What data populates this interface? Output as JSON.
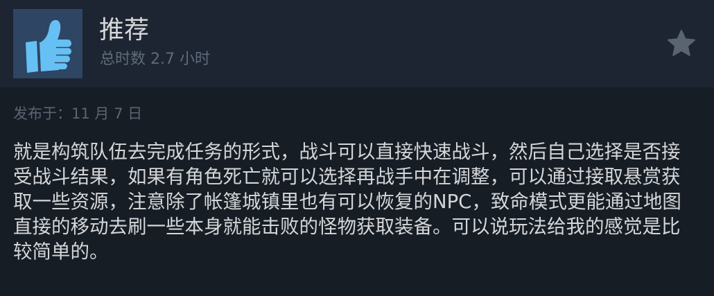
{
  "review": {
    "verdict": "推荐",
    "hours": "总时数 2.7 小时",
    "posted": "发布于：11 月 7 日",
    "text": "就是构筑队伍去完成任务的形式，战斗可以直接快速战斗，然后自己选择是否接受战斗结果，如果有角色死亡就可以选择再战手中在调整，可以通过接取悬赏获取一些资源，注意除了帐篷城镇里也有可以恢复的NPC，致命模式更能通过地图直接的移动去刷一些本身就能击败的怪物获取装备。可以说玩法给我的感觉是比较简单的。"
  },
  "icons": {
    "verdict_icon": "thumbs-up-icon",
    "award_icon": "star-icon"
  },
  "colors": {
    "background": "#171d25",
    "header_background": "#1d2532",
    "thumb_box": "#2e4563",
    "thumb_icon": "#66c0f4",
    "title_text": "#d6d7d8",
    "muted_text": "#5e6b7a",
    "body_text": "#d4d6d8",
    "star": "#5a6470"
  }
}
